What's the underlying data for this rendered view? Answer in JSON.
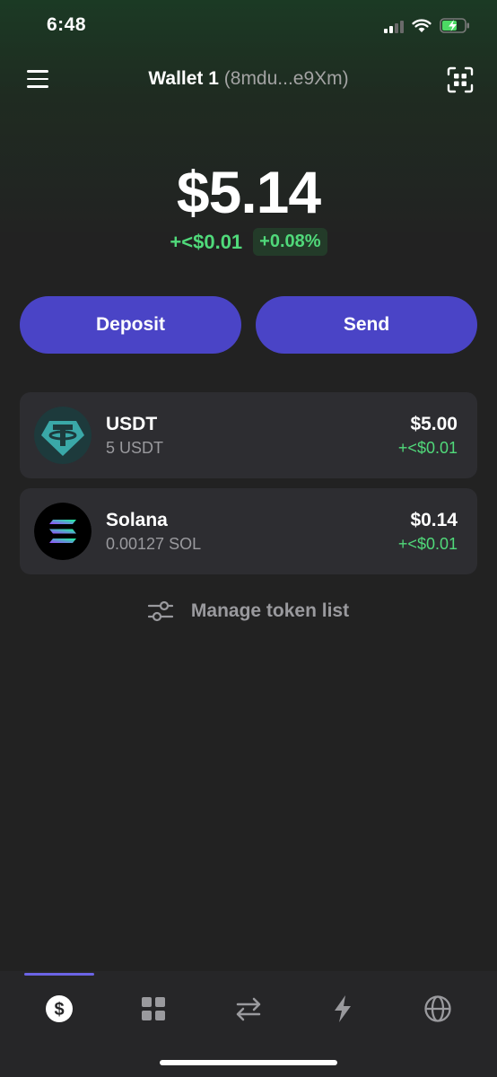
{
  "status_bar": {
    "time": "6:48"
  },
  "header": {
    "wallet_name": "Wallet 1",
    "wallet_address": "(8mdu...e9Xm)"
  },
  "balance": {
    "total": "$5.14",
    "change_abs": "+<$0.01",
    "change_pct": "+0.08%"
  },
  "actions": {
    "deposit_label": "Deposit",
    "send_label": "Send"
  },
  "tokens": [
    {
      "name": "USDT",
      "amount": "5 USDT",
      "value": "$5.00",
      "change": "+<$0.01",
      "icon": "tether-logo"
    },
    {
      "name": "Solana",
      "amount": "0.00127 SOL",
      "value": "$0.14",
      "change": "+<$0.01",
      "icon": "solana-logo"
    }
  ],
  "manage": {
    "label": "Manage token list"
  },
  "tabs": [
    {
      "name": "tokens",
      "icon": "dollar-icon",
      "active": true
    },
    {
      "name": "collectibles",
      "icon": "grid-icon",
      "active": false
    },
    {
      "name": "swap",
      "icon": "swap-arrows-icon",
      "active": false
    },
    {
      "name": "activity",
      "icon": "lightning-icon",
      "active": false
    },
    {
      "name": "browser",
      "icon": "globe-icon",
      "active": false
    }
  ],
  "colors": {
    "accent": "#4a44c6",
    "positive": "#50d97a",
    "background": "#222222",
    "card": "#2d2d31"
  }
}
